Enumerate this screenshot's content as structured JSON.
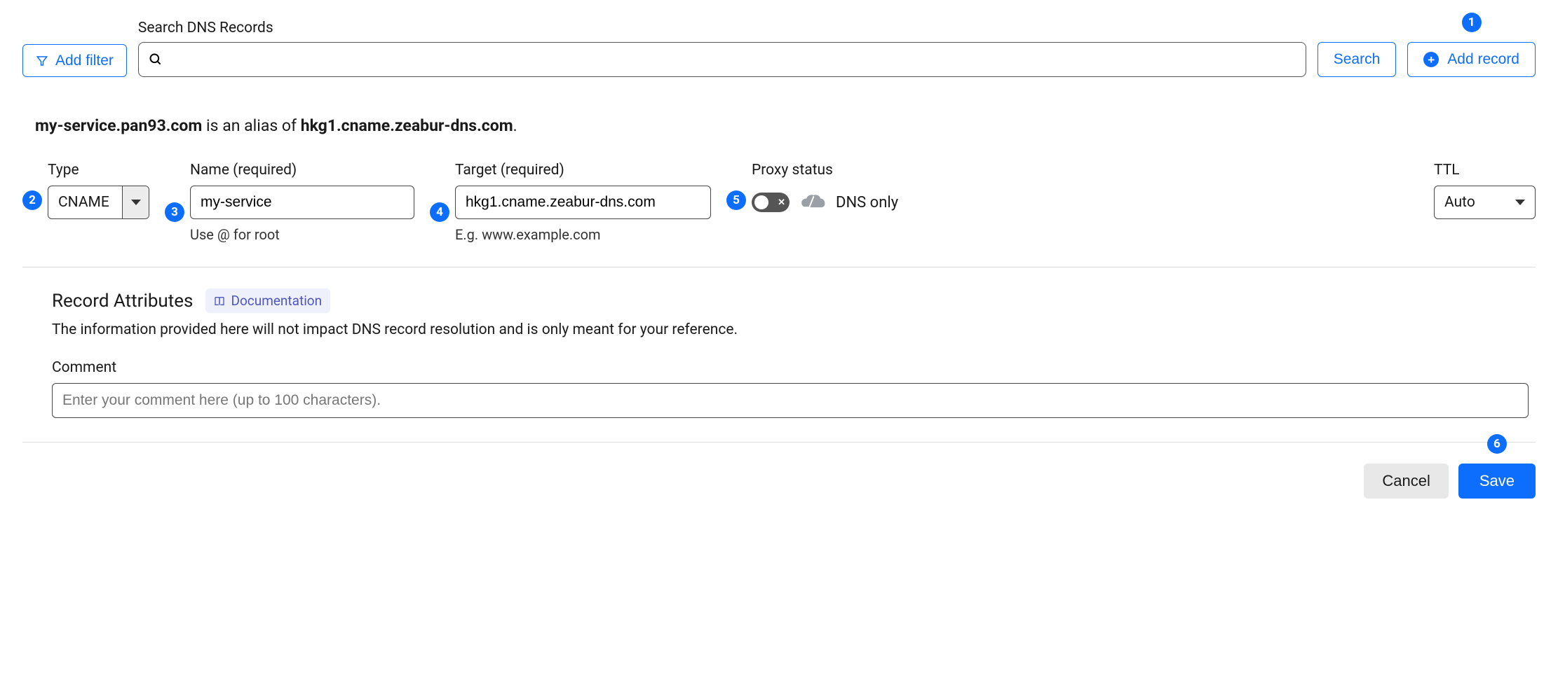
{
  "top": {
    "add_filter_label": "Add filter",
    "search_label": "Search DNS Records",
    "search_button": "Search",
    "add_record_label": "Add record"
  },
  "alias": {
    "domain": "my-service.pan93.com",
    "middle": " is an alias of ",
    "target": "hkg1.cname.zeabur-dns.com",
    "suffix": "."
  },
  "form": {
    "type_label": "Type",
    "type_value": "CNAME",
    "name_label": "Name (required)",
    "name_value": "my-service",
    "name_help": "Use @ for root",
    "target_label": "Target (required)",
    "target_value": "hkg1.cname.zeabur-dns.com",
    "target_help": "E.g. www.example.com",
    "proxy_label": "Proxy status",
    "proxy_value": "DNS only",
    "ttl_label": "TTL",
    "ttl_value": "Auto"
  },
  "attrs": {
    "title": "Record Attributes",
    "doc_label": "Documentation",
    "desc": "The information provided here will not impact DNS record resolution and is only meant for your reference.",
    "comment_label": "Comment",
    "comment_placeholder": "Enter your comment here (up to 100 characters)."
  },
  "footer": {
    "cancel": "Cancel",
    "save": "Save"
  },
  "badges": {
    "b1": "1",
    "b2": "2",
    "b3": "3",
    "b4": "4",
    "b5": "5",
    "b6": "6"
  }
}
